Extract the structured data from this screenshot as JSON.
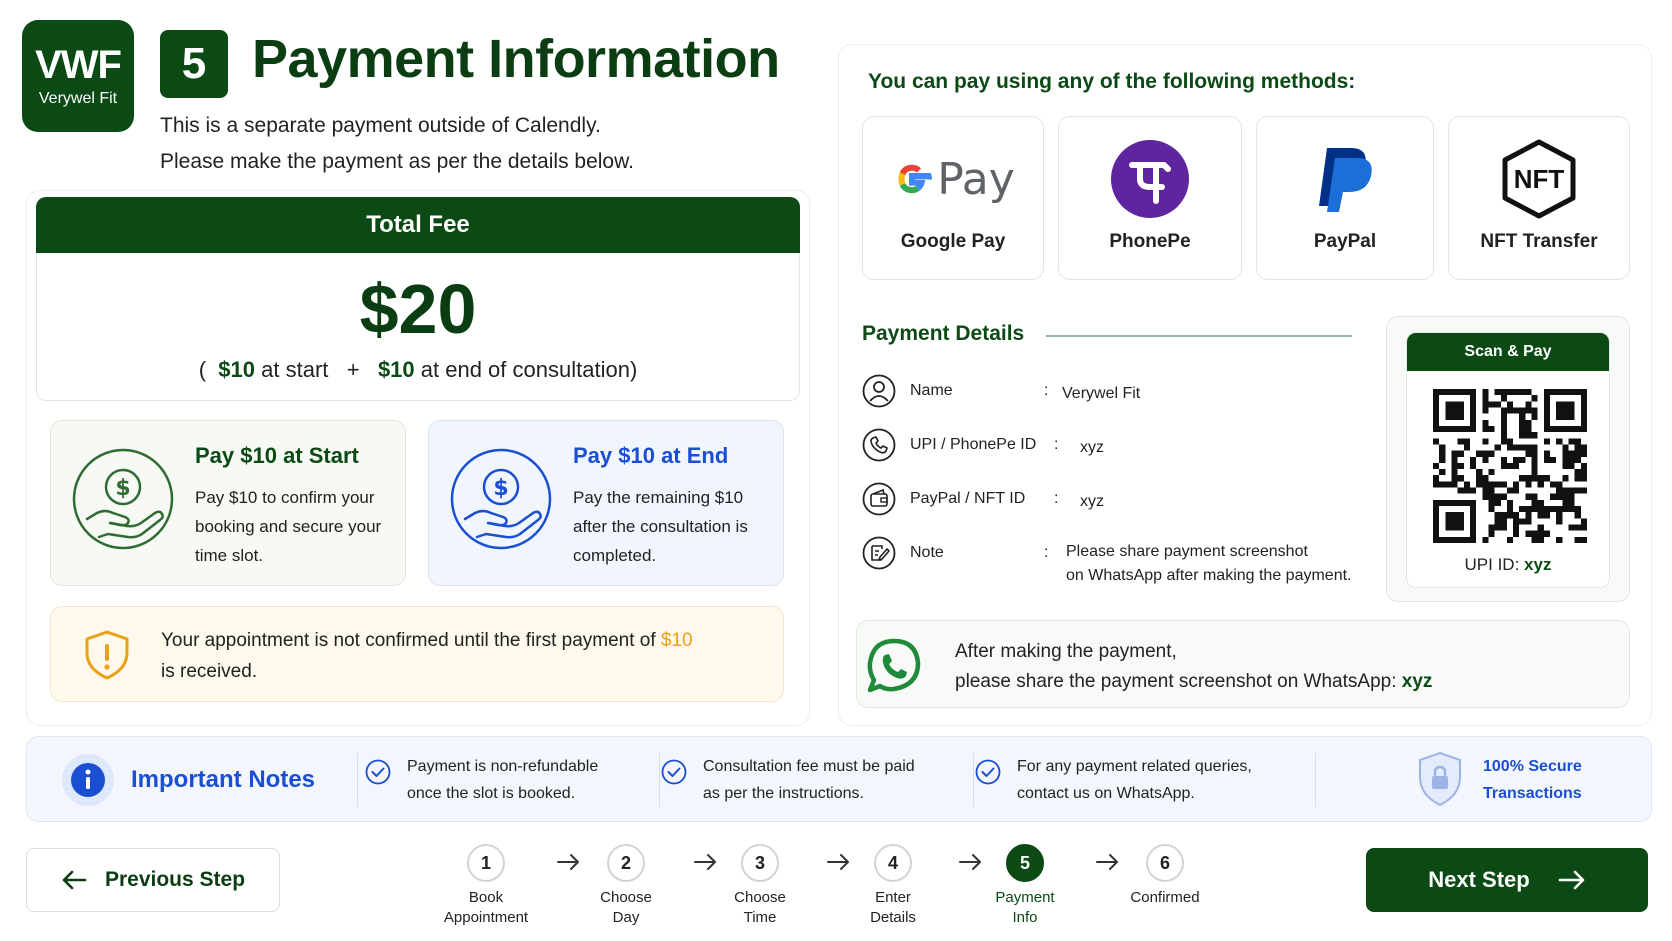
{
  "header": {
    "logo_line1": "VWF",
    "logo_line2": "Verywel Fit",
    "step_number": "5",
    "title": "Payment Information",
    "subtitle_line1": "This is a separate payment outside of Calendly.",
    "subtitle_line2": "Please make the payment as per the details below."
  },
  "fee": {
    "header": "Total Fee",
    "amount": "$20",
    "split_open": "(",
    "start_amount": "$10",
    "start_text": "at start",
    "plus": "+",
    "end_amount": "$10",
    "end_text": "at end of consultation",
    "split_close": ")"
  },
  "pay_start": {
    "title": "Pay $10 at Start",
    "desc": "Pay $10 to confirm your booking and secure your time slot."
  },
  "pay_end": {
    "title": "Pay $10 at End",
    "desc": "Pay the remaining $10 after the consultation is completed."
  },
  "warning": {
    "text_before": "Your appointment is not confirmed until the first payment of",
    "amount": "$10",
    "text_after": "is received."
  },
  "methods": {
    "title": "You can pay using any of the following methods:",
    "items": [
      {
        "label": "Google Pay",
        "logo_text": "Pay"
      },
      {
        "label": "PhonePe"
      },
      {
        "label": "PayPal"
      },
      {
        "label": "NFT Transfer",
        "logo_text": "NFT"
      }
    ]
  },
  "payment_details": {
    "title": "Payment Details",
    "rows": [
      {
        "icon": "user-icon",
        "label": "Name",
        "colon": ":",
        "value": "Verywel Fit"
      },
      {
        "icon": "phone-icon",
        "label": "UPI / PhonePe ID",
        "colon": ":",
        "value": "xyz"
      },
      {
        "icon": "wallet-icon",
        "label": "PayPal / NFT ID",
        "colon": ":",
        "value": "xyz"
      },
      {
        "icon": "note-icon",
        "label": "Note",
        "colon": ":",
        "value_line1": "Please share payment screenshot",
        "value_line2": "on WhatsApp after making the payment."
      }
    ]
  },
  "qr": {
    "header": "Scan & Pay",
    "upi_label": "UPI ID:",
    "upi_value": "xyz"
  },
  "whatsapp": {
    "line1": "After making the payment,",
    "line2": "please share the payment screenshot on WhatsApp:",
    "value": "xyz"
  },
  "notes": {
    "title": "Important Notes",
    "items": [
      {
        "line1": "Payment is non-refundable",
        "line2": "once the slot is booked."
      },
      {
        "line1": "Consultation fee must be paid",
        "line2": "as per the instructions."
      },
      {
        "line1": "For any payment related queries,",
        "line2": "contact us on WhatsApp."
      }
    ],
    "secure_line1": "100% Secure",
    "secure_line2": "Transactions"
  },
  "nav": {
    "prev_label": "Previous Step",
    "next_label": "Next Step",
    "steps": [
      {
        "num": "1",
        "line1": "Book",
        "line2": "Appointment"
      },
      {
        "num": "2",
        "line1": "Choose",
        "line2": "Day"
      },
      {
        "num": "3",
        "line1": "Choose",
        "line2": "Time"
      },
      {
        "num": "4",
        "line1": "Enter",
        "line2": "Details"
      },
      {
        "num": "5",
        "line1": "Payment",
        "line2": "Info"
      },
      {
        "num": "6",
        "line1": "Confirmed",
        "line2": ""
      }
    ],
    "active_step": 5
  },
  "colors": {
    "brand_green": "#0b4a14",
    "accent_blue": "#1b4fd1",
    "warning_amber": "#e9a216",
    "whatsapp_green": "#1f8a3a",
    "phonepe_purple": "#5f259f"
  }
}
